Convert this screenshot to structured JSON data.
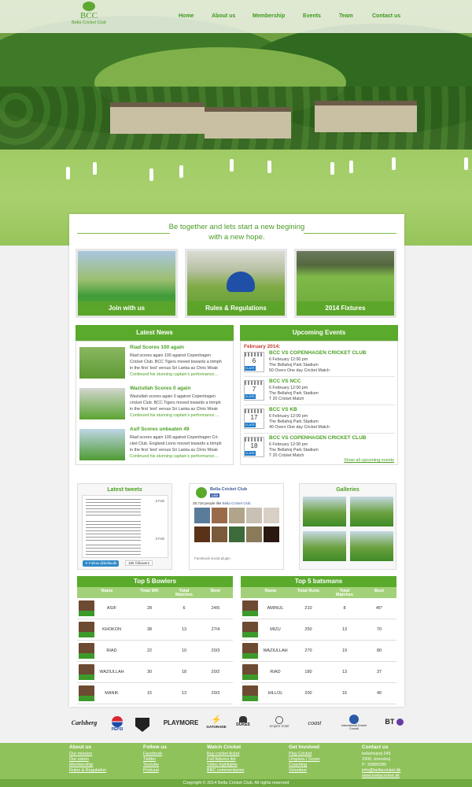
{
  "logo": {
    "abbr": "BCC",
    "name": "Bella Cricket Club"
  },
  "nav": [
    "Home",
    "About us",
    "Membership",
    "Events",
    "Team",
    "Contact us"
  ],
  "tagline": {
    "line1": "Be together and lets start a new begining",
    "line2": "with a new hope."
  },
  "tiles": [
    {
      "label": "Join with us"
    },
    {
      "label": "Rules & Regulations"
    },
    {
      "label": "2014 Fixtures"
    }
  ],
  "news": {
    "heading": "Latest News",
    "items": [
      {
        "title": "Riad Scores 100 again",
        "l1": "Riad scores again 100 against Copenhagen",
        "l2": "Cricket Club. BCC Tigers moved towards a trimph",
        "l3": "in the first ‘test’ versus Sri Lanka as  Chris Woak",
        "more": "Continued his stunning captain’s performance...."
      },
      {
        "title": "Waziullah Scores 0 again",
        "l1": "Waziullah scores again 0 against Copenhagen",
        "l2": "cricket Club. BCC Tigers moved towards a trimph",
        "l3": "in the first ‘test’ versus Sri Lanka as  Chris Woak",
        "more": "Continued his stunning captain’s performance...."
      },
      {
        "title": "Asif Scores unbeaten 49",
        "l1": "Riad scores again 100 against Copenhagen Cri-",
        "l2": "cket Club. England Lions moved towards a trimph",
        "l3": "in the first ‘test’ versus Sri Lanka as  Chris Woak",
        "more": "Continued his stunning captain’s performance...."
      }
    ]
  },
  "events": {
    "heading": "Upcoming Events",
    "month": "February 2014:",
    "btn": "D-ATE",
    "items": [
      {
        "day": "6",
        "title": "BCC VS COPENHAGEN CRICKET CLUB",
        "date": "6 February 12:00 pm",
        "venue": "The Bellahoj Park Stadium",
        "type": "50 Overs One day Cricket Match"
      },
      {
        "day": "7",
        "title": "BCC VS NCC",
        "date": "6 February 12:00 pm",
        "venue": "The Bellahoj Park Stadium",
        "type": "T 20 Cricket Match"
      },
      {
        "day": "17",
        "title": "BCC VS KB",
        "date": "6 February 12:00 pm",
        "venue": "The Bellahoj Park Stadium",
        "type": "40 Overs One day Cricket Match"
      },
      {
        "day": "18",
        "title": "BCC VS COPENHAGEN CRICKET CLUB",
        "date": "6 February 12:00 pm",
        "venue": "The Bellahoj Park Stadium",
        "type": "T 20 Cricket Match"
      }
    ],
    "show_all": "Show all upcoming events"
  },
  "tweets": {
    "heading": "Latest tweets",
    "follow": "Follow @bellacdk",
    "followers": "18K followers",
    "date1": "3 Feb",
    "date2": "3 Feb"
  },
  "facebook": {
    "page": "Bella Cricket Club",
    "like": "Like",
    "count": "28,718 people like",
    "count_link": "Bella Cricket Club",
    "plugin": "Facebook social plugin"
  },
  "galleries": {
    "heading": "Galleries"
  },
  "bowlers": {
    "heading": "Top 5 Bowlers",
    "cols": [
      "Name",
      "Total WK",
      "Total Matches",
      "Best"
    ],
    "rows": [
      [
        "ASIF",
        "28",
        "6",
        "24/5"
      ],
      [
        "KHOKON",
        "38",
        "13",
        "27/4"
      ],
      [
        "RIAD",
        "22",
        "10",
        "20/3"
      ],
      [
        "WAZIULLAH",
        "30",
        "18",
        "20/2"
      ],
      [
        "MANIK",
        "15",
        "13",
        "20/3"
      ]
    ]
  },
  "batsmen": {
    "heading": "Top 5 batsmans",
    "cols": [
      "Name",
      "Total Runs",
      "Total Matches",
      "Best"
    ],
    "rows": [
      [
        "AMINUL",
        "210",
        "8",
        "45*"
      ],
      [
        "MIZU",
        "250",
        "13",
        "70"
      ],
      [
        "WAZIULLAH",
        "270",
        "19",
        "80"
      ],
      [
        "RIAD",
        "180",
        "13",
        "37"
      ],
      [
        "HILLOL",
        "200",
        "16",
        "40"
      ]
    ]
  },
  "sponsors": [
    "Carlsberg",
    "PEPSI",
    "",
    "PLAYMORE",
    "GATORADE",
    "DUKES",
    "empire hotel",
    "coast",
    "International Cricket Council",
    "BT"
  ],
  "footer": {
    "about": {
      "h": "About us",
      "links": [
        "Our mission",
        "Our vision",
        "Membership",
        "Rules & Regulation"
      ]
    },
    "follow": {
      "h": "Follow us",
      "links": [
        "Facebook",
        "Twitter",
        "Youtube",
        "Podcast"
      ]
    },
    "watch": {
      "h": "Watch Cricket",
      "links": [
        "Buy cricket ticket",
        "Full fixtures list",
        "Video highlights",
        "BBC commentaries"
      ]
    },
    "involved": {
      "h": "Get Involved",
      "links": [
        "Play Cricket",
        "Umpires / Score",
        "Coaching",
        "Volunteer"
      ]
    },
    "contact": {
      "h": "Contact us",
      "links": [
        "bellahojvej 245",
        "2300, bronshoj",
        "P: 30880386",
        "info@bellacricket.dk",
        "www.bellacricket.dk"
      ]
    },
    "copyright": "Copyright © 2014 Bella Cricket Club. All rights reserved"
  },
  "colors": {
    "brand": "#5aaa2c",
    "footer": "#8fc25b",
    "accent_blue": "#1f7ac7",
    "month_red": "#c0392b"
  }
}
